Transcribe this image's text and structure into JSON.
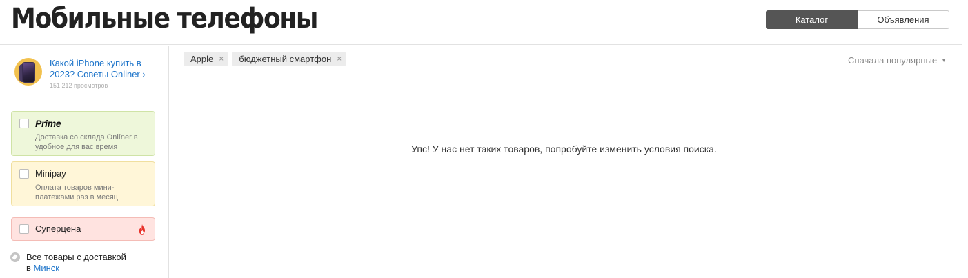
{
  "header": {
    "title": "Мобильные телефоны",
    "tabs": [
      {
        "label": "Каталог",
        "active": true
      },
      {
        "label": "Объявления",
        "active": false
      }
    ]
  },
  "sidebar": {
    "promo": {
      "text": "Какой iPhone купить в 2023? Советы Onliner ›",
      "views": "151 212 просмотров"
    },
    "cards": {
      "prime": {
        "title": "Prime",
        "desc": "Доставка со склада Onlíner в удобное для вас время"
      },
      "minipay": {
        "title": "Minipay",
        "desc": "Оплата товаров мини-платежами раз в месяц"
      },
      "super": {
        "title": "Суперцена",
        "icon": "fire-icon"
      }
    },
    "delivery": {
      "text": "Все товары с доставкой",
      "prefix": "в",
      "city": "Минск"
    }
  },
  "filters": [
    {
      "label": "Apple",
      "remove": "×"
    },
    {
      "label": "бюджетный смартфон",
      "remove": "×"
    }
  ],
  "sort": {
    "label": "Сначала популярные",
    "caret": "▼"
  },
  "empty_message": "Упс! У нас нет таких товаров, попробуйте изменить условия поиска.",
  "colors": {
    "accent_link": "#1b73c9",
    "active_tab": "#555555",
    "prime_bg": "#eef7da",
    "minipay_bg": "#fff6d8",
    "super_bg": "#ffe3e0",
    "fire": "#e8332b"
  }
}
